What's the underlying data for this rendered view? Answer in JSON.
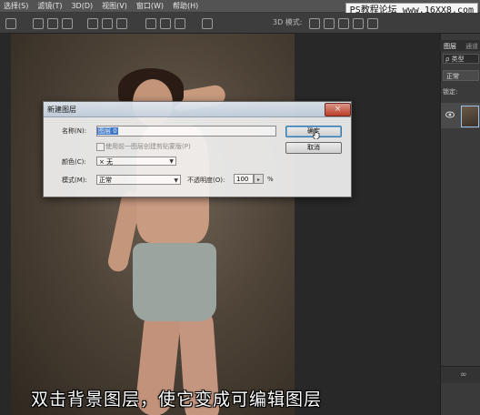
{
  "menubar": {
    "items": [
      "选择(S)",
      "滤镜(T)",
      "3D(D)",
      "视图(V)",
      "窗口(W)",
      "帮助(H)"
    ]
  },
  "watermark": "PS教程论坛 www.16XX8.com",
  "options_bar": {
    "mode_3d_label": "3D 模式:"
  },
  "layers_panel": {
    "tabs": [
      "图层",
      "通道"
    ],
    "filter_placeholder": "ρ 类型",
    "blend_mode": "正常",
    "lock_label": "锁定:",
    "icons": [
      "eye-icon",
      "link-icon"
    ]
  },
  "dialog": {
    "title": "新建图层",
    "name_label": "名称(N):",
    "name_value": "图层 0",
    "clip_label": "使用前一图层创建剪贴蒙版(P)",
    "color_label": "颜色(C):",
    "color_value": "× 无",
    "mode_label": "模式(M):",
    "mode_value": "正常",
    "opacity_label": "不透明度(O):",
    "opacity_value": "100",
    "opacity_unit": "%",
    "ok_label": "确定",
    "cancel_label": "取消",
    "close_glyph": "×"
  },
  "caption": "双击背景图层，使它变成可编辑图层",
  "colors": {
    "accent": "#3a7bd5",
    "close": "#c8402a"
  }
}
